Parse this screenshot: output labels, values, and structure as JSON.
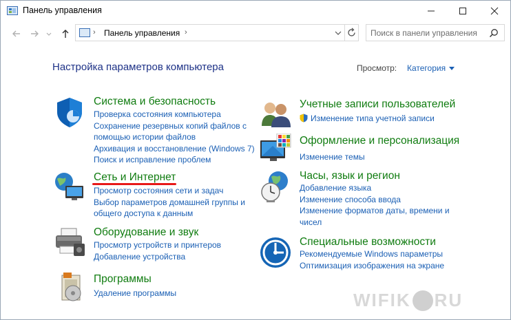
{
  "window": {
    "title": "Панель управления"
  },
  "nav": {
    "address_crumb": "Панель управления",
    "search_placeholder": "Поиск в панели управления"
  },
  "main": {
    "heading": "Настройка параметров компьютера",
    "view_label": "Просмотр:",
    "view_value": "Категория"
  },
  "categories": [
    {
      "title": "Система и безопасность",
      "icon": "shield-icon",
      "links": [
        "Проверка состояния компьютера",
        "Сохранение резервных копий файлов с",
        "помощью истории файлов",
        "Архивация и восстановление (Windows 7)",
        "Поиск и исправление проблем"
      ]
    },
    {
      "title": "Сеть и Интернет",
      "icon": "globe-network-icon",
      "links": [
        "Просмотр состояния сети и задач",
        "Выбор параметров домашней группы и",
        "общего доступа к данным"
      ]
    },
    {
      "title": "Оборудование и звук",
      "icon": "printer-icon",
      "links": [
        "Просмотр устройств и принтеров",
        "Добавление устройства"
      ]
    },
    {
      "title": "Программы",
      "icon": "programs-icon",
      "links": [
        "Удаление программы"
      ]
    },
    {
      "title": "Учетные записи пользователей",
      "icon": "users-icon",
      "links": [
        "Изменение типа учетной записи"
      ]
    },
    {
      "title": "Оформление и персонализация",
      "icon": "display-palette-icon",
      "links": [
        "Изменение темы"
      ]
    },
    {
      "title": "Часы, язык и регион",
      "icon": "clock-globe-icon",
      "links": [
        "Добавление языка",
        "Изменение способа ввода",
        "Изменение форматов даты, времени и",
        "чисел"
      ]
    },
    {
      "title": "Специальные возможности",
      "icon": "accessibility-icon",
      "links": [
        "Рекомендуемые Windows параметры",
        "Оптимизация изображения на экране"
      ]
    }
  ],
  "watermark": {
    "left": "WIFIK",
    "right": "RU"
  }
}
